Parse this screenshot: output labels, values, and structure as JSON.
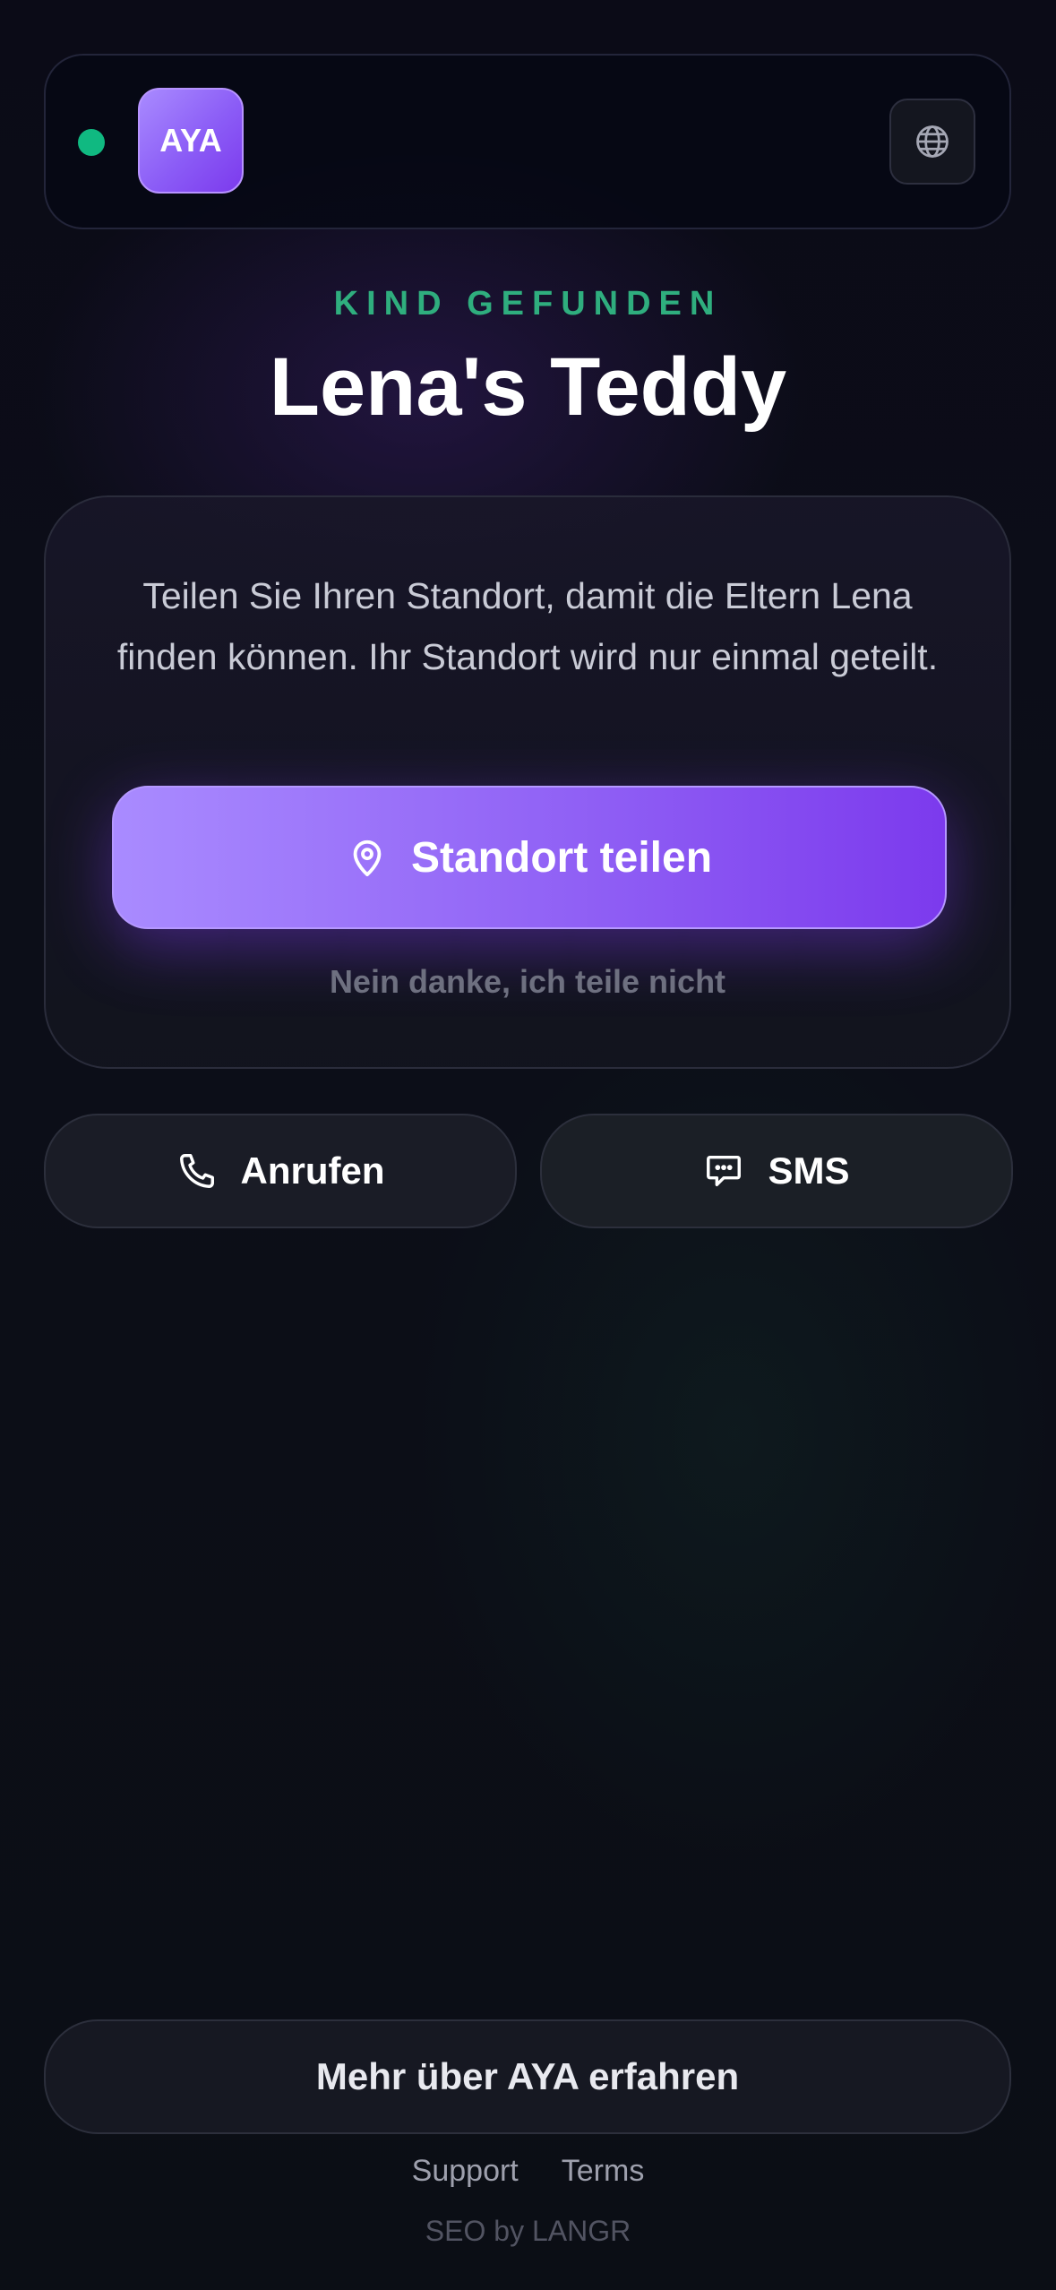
{
  "header": {
    "logo_text": "AYA",
    "status_color": "#10b981",
    "language_icon": "globe-icon"
  },
  "hero": {
    "eyebrow": "KIND GEFUNDEN",
    "title": "Lena's Teddy"
  },
  "card": {
    "message": "Teilen Sie Ihren Standort, damit die Eltern Lena finden können. Ihr Standort wird nur einmal geteilt.",
    "share_label": "Standort teilen",
    "share_icon": "location-pin-icon",
    "decline_label": "Nein danke, ich teile nicht",
    "accent_color": "#8b5cf6"
  },
  "contact": {
    "call_label": "Anrufen",
    "call_icon": "phone-icon",
    "sms_label": "SMS",
    "sms_icon": "chat-bubble-icon"
  },
  "footer": {
    "more_label": "Mehr über AYA erfahren",
    "links": [
      "Support",
      "Terms"
    ],
    "credit": "SEO by LANGR"
  }
}
